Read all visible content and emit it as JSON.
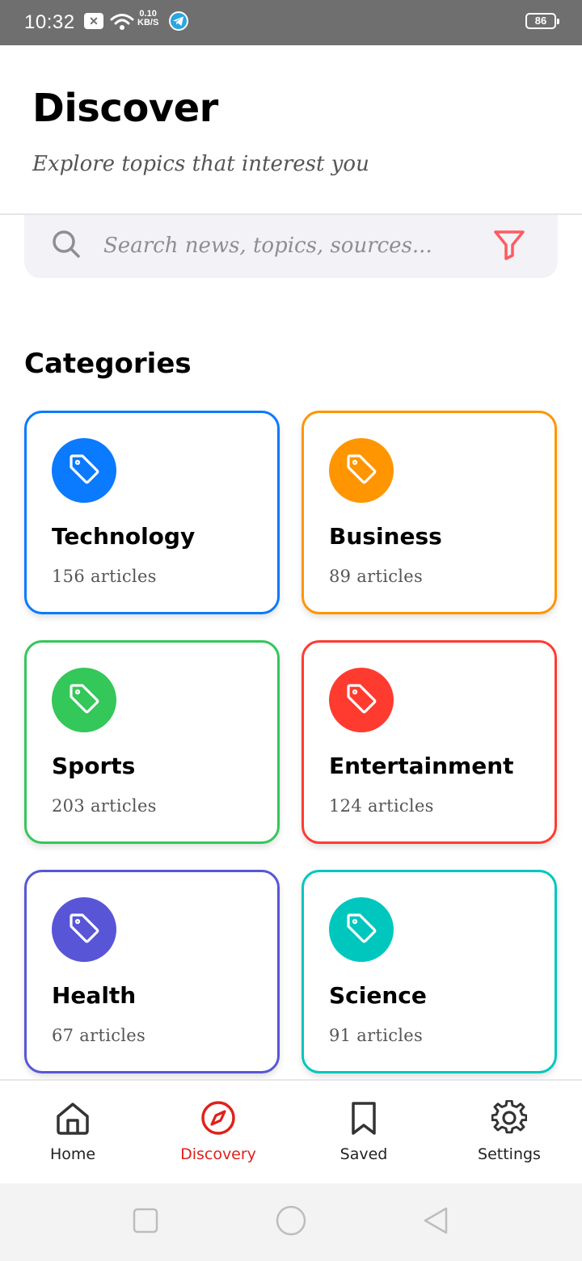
{
  "status_bar": {
    "time": "10:32",
    "net_speed_value": "0.10",
    "net_speed_unit": "KB/S",
    "battery": "86"
  },
  "header": {
    "title": "Discover",
    "subtitle": "Explore topics that interest you"
  },
  "search": {
    "placeholder": "Search news, topics, sources...",
    "value": ""
  },
  "categories": {
    "heading": "Categories",
    "items": [
      {
        "name": "Technology",
        "count": "156 articles",
        "color": "#0a7aff",
        "icon": "tag-icon"
      },
      {
        "name": "Business",
        "count": "89 articles",
        "color": "#ff9500",
        "icon": "tag-icon"
      },
      {
        "name": "Sports",
        "count": "203 articles",
        "color": "#34c759",
        "icon": "tag-icon"
      },
      {
        "name": "Entertainment",
        "count": "124 articles",
        "color": "#ff3b30",
        "icon": "tag-icon"
      },
      {
        "name": "Health",
        "count": "67 articles",
        "color": "#5856d6",
        "icon": "tag-icon"
      },
      {
        "name": "Science",
        "count": "91 articles",
        "color": "#00c7be",
        "icon": "tag-icon"
      }
    ]
  },
  "bottom_nav": {
    "active_color": "#e0211d",
    "items": [
      {
        "label": "Home",
        "icon": "home-icon"
      },
      {
        "label": "Discovery",
        "icon": "compass-icon",
        "active": true
      },
      {
        "label": "Saved",
        "icon": "bookmark-icon"
      },
      {
        "label": "Settings",
        "icon": "gear-icon"
      }
    ]
  }
}
